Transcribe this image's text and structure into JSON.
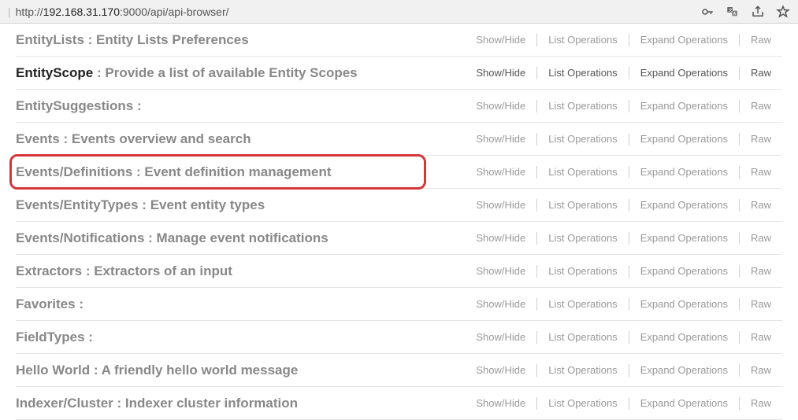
{
  "addressBar": {
    "prefix": "http://",
    "host": "192.168.31.170",
    "port_path": ":9000/api/api-browser/"
  },
  "actions": {
    "showHide": "Show/Hide",
    "listOps": "List Operations",
    "expandOps": "Expand Operations",
    "raw": "Raw"
  },
  "rows": [
    {
      "name": "EntityLists",
      "desc": "Entity Lists Preferences",
      "active": false,
      "highlighted": false
    },
    {
      "name": "EntityScope",
      "desc": "Provide a list of available Entity Scopes",
      "active": true,
      "highlighted": false
    },
    {
      "name": "EntitySuggestions",
      "desc": "",
      "active": false,
      "highlighted": false
    },
    {
      "name": "Events",
      "desc": "Events overview and search",
      "active": false,
      "highlighted": false
    },
    {
      "name": "Events/Definitions",
      "desc": "Event definition management",
      "active": false,
      "highlighted": true
    },
    {
      "name": "Events/EntityTypes",
      "desc": "Event entity types",
      "active": false,
      "highlighted": false
    },
    {
      "name": "Events/Notifications",
      "desc": "Manage event notifications",
      "active": false,
      "highlighted": false
    },
    {
      "name": "Extractors",
      "desc": "Extractors of an input",
      "active": false,
      "highlighted": false
    },
    {
      "name": "Favorites",
      "desc": "",
      "active": false,
      "highlighted": false
    },
    {
      "name": "FieldTypes",
      "desc": "",
      "active": false,
      "highlighted": false
    },
    {
      "name": "Hello World",
      "desc": "A friendly hello world message",
      "active": false,
      "highlighted": false
    },
    {
      "name": "Indexer/Cluster",
      "desc": "Indexer cluster information",
      "active": false,
      "highlighted": false
    }
  ]
}
